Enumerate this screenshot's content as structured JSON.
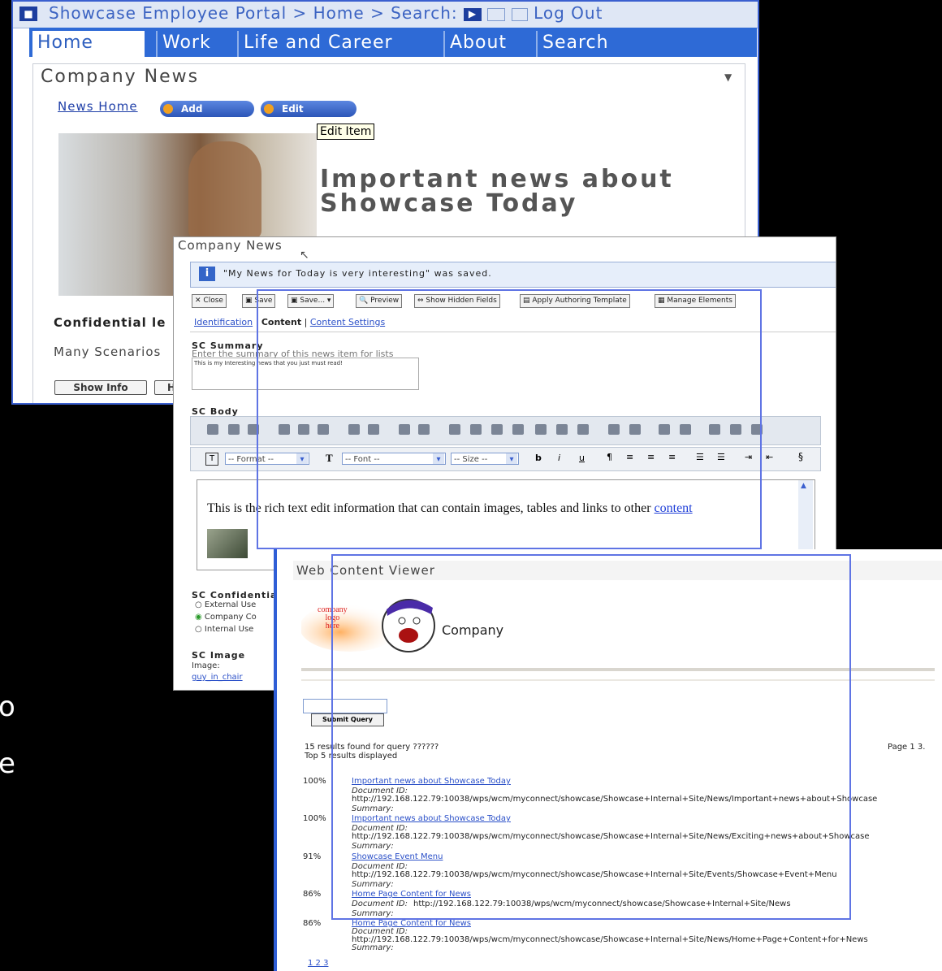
{
  "portal": {
    "breadcrumb": "Showcase Employee Portal > Home > Search:",
    "logout": "Log Out",
    "tabs": [
      "Home",
      "Work",
      "Life and Career",
      "About",
      "Search"
    ],
    "portlet_title": "Company News",
    "news_home": "News Home",
    "add_label": "Add",
    "edit_label": "Edit",
    "tooltip": "Edit Item",
    "headline": "Important news about Showcase Today",
    "confidential": "Confidential le",
    "scenarios": "Many Scenarios",
    "show_info": "Show Info",
    "partial_button": "H"
  },
  "editor": {
    "window_title": "Company News",
    "saved_message": "\"My News for Today is very interesting\" was saved.",
    "toolbar": [
      "Close",
      "Save",
      "Save...",
      "Preview",
      "Show Hidden Fields",
      "Apply Authoring Template",
      "Manage Elements"
    ],
    "tab_identification": "Identification",
    "tab_content": "Content",
    "tab_settings": "Content Settings",
    "summary_label": "SC Summary",
    "summary_hint": "Enter the summary of this news item for lists",
    "summary_value": "This is my Interesting news that you just must read!",
    "body_label": "SC Body",
    "format_select": "-- Format --",
    "font_select": "-- Font --",
    "size_select": "-- Size --",
    "body_text": "This is the rich text edit information that can contain images, tables and links to other",
    "body_link": "content",
    "confidential_label": "SC Confidentia",
    "options": [
      "External Use",
      "Company Co",
      "Internal Use"
    ],
    "image_label": "SC Image",
    "image_field": "Image:",
    "image_file": "guy_in_chair"
  },
  "viewer": {
    "window_title": "Web Content Viewer",
    "logo_text": [
      "company",
      "logo",
      "here"
    ],
    "company": "Company",
    "submit": "Submit Query",
    "results_found": "15 results found for query ??????",
    "top_displayed": "Top 5 results displayed",
    "page": "Page 1 3.",
    "doc_id_label": "Document ID:",
    "summary_label": "Summary:",
    "results": [
      {
        "pct": "100%",
        "title": "Important news about Showcase Today",
        "url": "http://192.168.122.79:10038/wps/wcm/myconnect/showcase/Showcase+Internal+Site/News/Important+news+about+Showcase"
      },
      {
        "pct": "100%",
        "title": "Important news about Showcase Today",
        "url": "http://192.168.122.79:10038/wps/wcm/myconnect/showcase/Showcase+Internal+Site/News/Exciting+news+about+Showcase"
      },
      {
        "pct": "91%",
        "title": "Showcase Event Menu",
        "url": "http://192.168.122.79:10038/wps/wcm/myconnect/showcase/Showcase+Internal+Site/Events/Showcase+Event+Menu"
      },
      {
        "pct": "86%",
        "title": "Home Page Content for News",
        "url": "http://192.168.122.79:10038/wps/wcm/myconnect/showcase/Showcase+Internal+Site/News"
      },
      {
        "pct": "86%",
        "title": "Home Page Content for News",
        "url": "http://192.168.122.79:10038/wps/wcm/myconnect/showcase/Showcase+Internal+Site/News/Home+Page+Content+for+News"
      }
    ],
    "pager": "1 2 3"
  },
  "side_text": [
    "o",
    "e"
  ],
  "colors": {
    "accent": "#2e6ad6",
    "highlight": "#5f74e4",
    "background": "#000000"
  }
}
